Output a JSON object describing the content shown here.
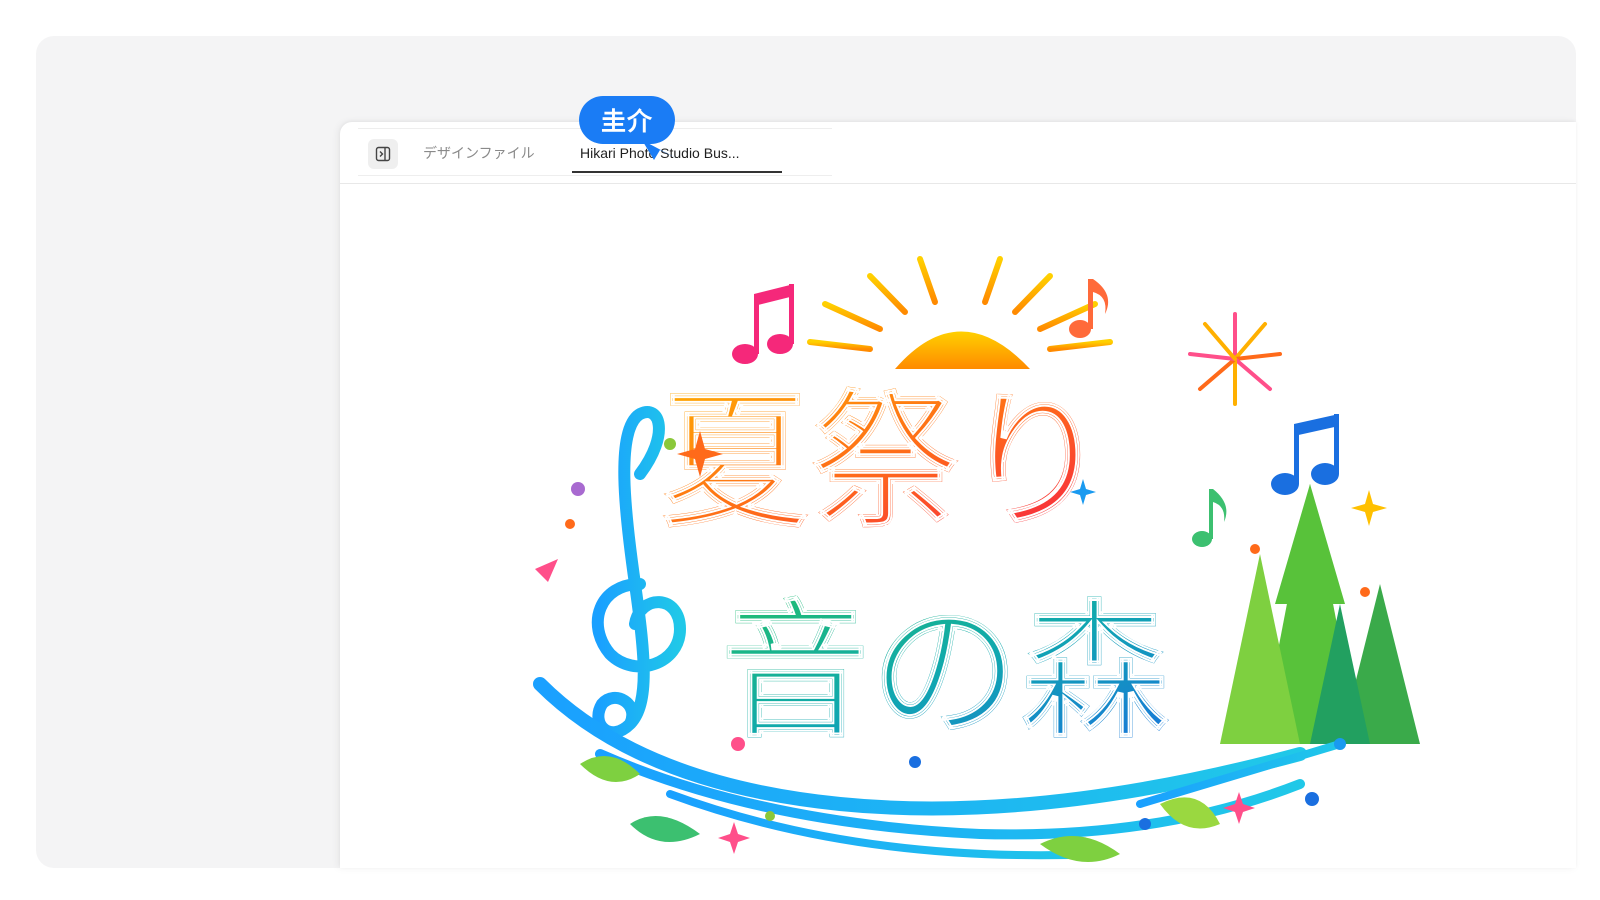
{
  "tabs": [
    {
      "label": "デザインファイル",
      "active": false
    },
    {
      "label": "Hikari Photo Studio Bus...",
      "active": true
    }
  ],
  "cursor": {
    "user_name": "圭介",
    "color": "#1a7cf5"
  },
  "artwork": {
    "title_line1": "夏祭り",
    "title_line2": "音の森",
    "icons": [
      "sun",
      "music-note",
      "treble-clef",
      "fireworks",
      "pine-tree",
      "wave",
      "leaf",
      "sparkle"
    ]
  },
  "colors": {
    "frame_bg": "#f4f4f5",
    "window_bg": "#ffffff",
    "accent": "#1a7cf5"
  }
}
